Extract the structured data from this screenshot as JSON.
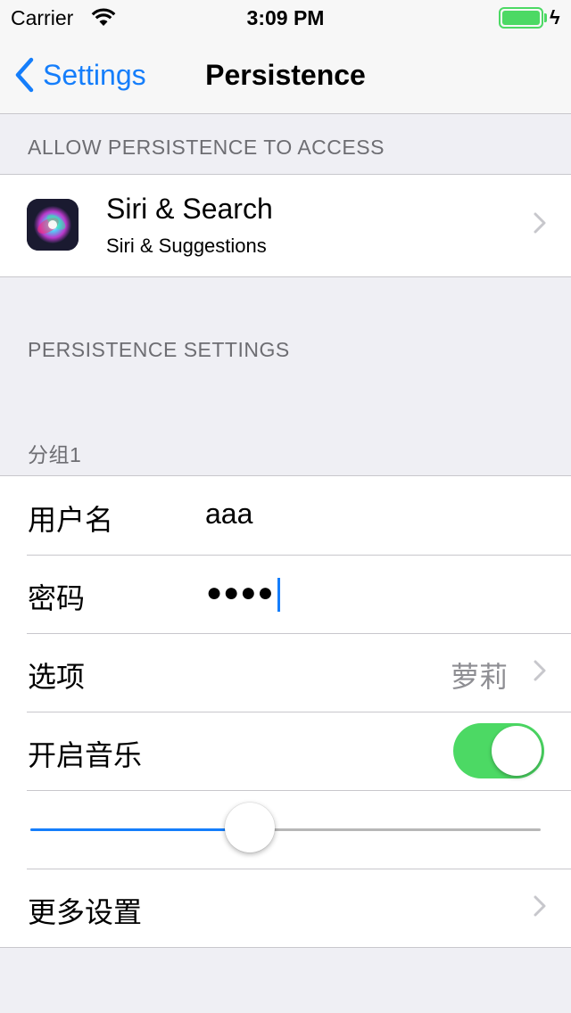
{
  "status_bar": {
    "carrier": "Carrier",
    "time": "3:09 PM",
    "battery_level": 1.0
  },
  "nav": {
    "back_label": "Settings",
    "title": "Persistence"
  },
  "section_access": {
    "header": "ALLOW PERSISTENCE TO ACCESS",
    "siri": {
      "title": "Siri & Search",
      "subtitle": "Siri & Suggestions"
    }
  },
  "section_settings": {
    "header": "PERSISTENCE SETTINGS"
  },
  "group1": {
    "header": "分组1",
    "username": {
      "label": "用户名",
      "value": "aaa"
    },
    "password": {
      "label": "密码",
      "masked": "●●●●"
    },
    "option": {
      "label": "选项",
      "value": "萝莉"
    },
    "music": {
      "label": "开启音乐",
      "on": true
    },
    "slider": {
      "value": 0.43
    },
    "more": {
      "label": "更多设置"
    }
  },
  "colors": {
    "accent": "#157efb",
    "toggle_on": "#4cd964",
    "background": "#efeff4"
  },
  "icons": [
    "wifi-icon",
    "battery-icon",
    "bolt-icon",
    "back-chevron-icon",
    "siri-icon",
    "chevron-right-icon"
  ]
}
